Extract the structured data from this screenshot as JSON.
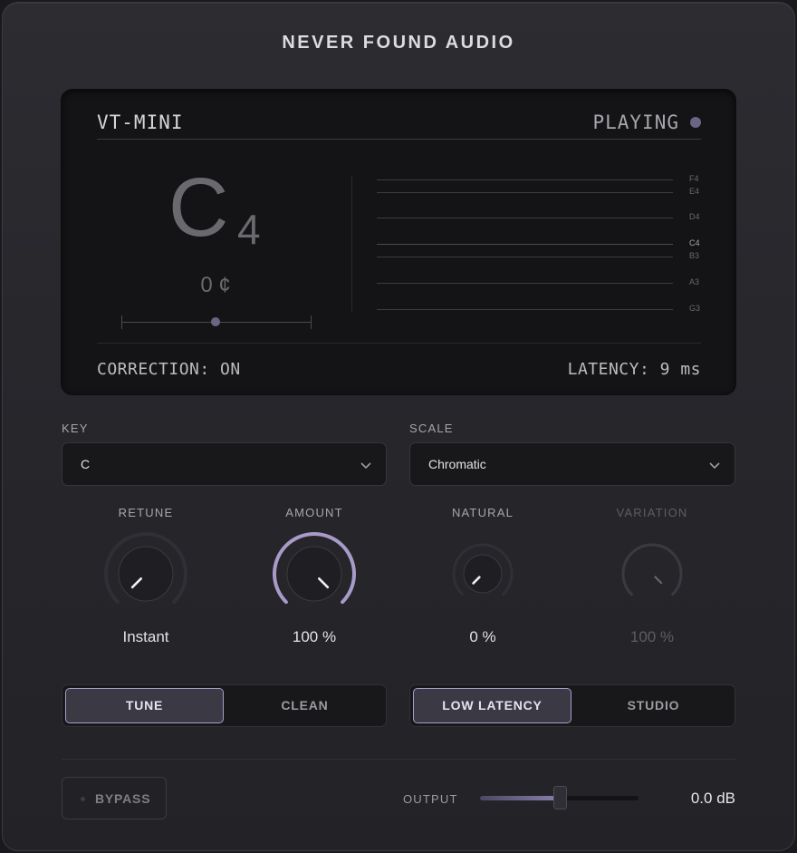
{
  "brand": "NEVER FOUND AUDIO",
  "display": {
    "title": "VT-MINI",
    "status": "PLAYING",
    "note_letter": "C",
    "note_octave": "4",
    "cents": "0 ¢",
    "cents_value": 0,
    "pitch_labels": [
      "F4",
      "E4",
      "D4",
      "C4",
      "B3",
      "A3",
      "G3"
    ],
    "active_pitch": "C4",
    "correction": "CORRECTION: ON",
    "latency": "LATENCY: 9 ms"
  },
  "key": {
    "label": "KEY",
    "value": "C"
  },
  "scale": {
    "label": "SCALE",
    "value": "Chromatic"
  },
  "knobs": {
    "retune": {
      "label": "RETUNE",
      "value": "Instant",
      "level": 0.0
    },
    "amount": {
      "label": "AMOUNT",
      "value": "100 %",
      "level": 1.0
    },
    "natural": {
      "label": "NATURAL",
      "value": "0 %",
      "level": 0.0
    },
    "variation": {
      "label": "VARIATION",
      "value": "100 %",
      "level": 1.0,
      "disabled": true
    }
  },
  "mode": {
    "options": [
      "TUNE",
      "CLEAN"
    ],
    "selected": "TUNE"
  },
  "latency_mode": {
    "options": [
      "LOW LATENCY",
      "STUDIO"
    ],
    "selected": "LOW LATENCY"
  },
  "bypass": {
    "label": "BYPASS"
  },
  "output": {
    "label": "OUTPUT",
    "value": "0.0 dB",
    "level": 0.5
  },
  "colors": {
    "accent": "#a99bc9",
    "led": "#6b6585",
    "panel": "#27272c",
    "display": "#141416"
  }
}
